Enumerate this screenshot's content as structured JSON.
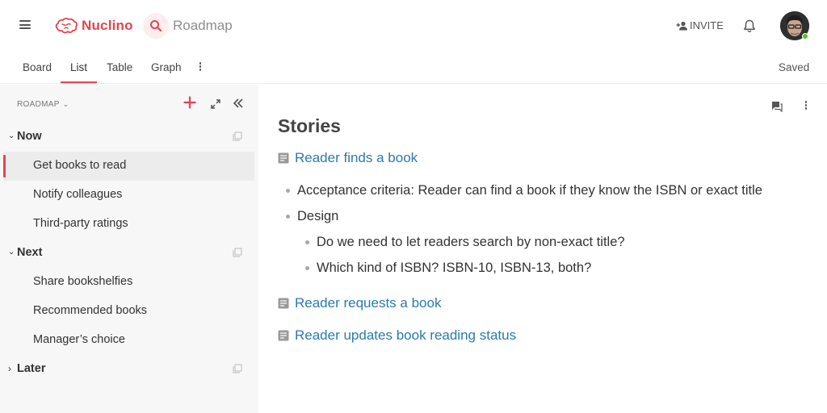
{
  "app": {
    "brand": "Nuclino",
    "workspace": "Roadmap",
    "accent": "#e6434f"
  },
  "header": {
    "invite_label": "INVITE",
    "icons": [
      "menu-icon",
      "brain-logo-icon",
      "search-icon",
      "add-person-icon",
      "bell-icon"
    ]
  },
  "tabs": [
    {
      "label": "Board"
    },
    {
      "label": "List"
    },
    {
      "label": "Table"
    },
    {
      "label": "Graph"
    }
  ],
  "active_tab": "List",
  "status": "Saved",
  "sidebar": {
    "header": "ROADMAP",
    "groups": [
      {
        "label": "Now",
        "expanded": true,
        "items": [
          {
            "label": "Get books to read",
            "active": true
          },
          {
            "label": "Notify colleagues"
          },
          {
            "label": "Third-party ratings"
          }
        ]
      },
      {
        "label": "Next",
        "expanded": true,
        "items": [
          {
            "label": "Share bookshelfies"
          },
          {
            "label": "Recommended books"
          },
          {
            "label": "Manager’s choice"
          }
        ]
      },
      {
        "label": "Later",
        "expanded": false,
        "items": []
      }
    ]
  },
  "document": {
    "title": "Stories",
    "links": [
      {
        "label": "Reader finds a book"
      },
      {
        "label": "Reader requests a book"
      },
      {
        "label": "Reader updates book reading status"
      }
    ],
    "bullets": [
      {
        "text": "Acceptance criteria: Reader can find a book if they know the ISBN or exact title"
      },
      {
        "text": "Design"
      }
    ],
    "sub_bullets": [
      {
        "text": "Do we need to let readers search by non-exact title?"
      },
      {
        "text": "Which kind of ISBN? ISBN-10, ISBN-13, both?"
      }
    ]
  }
}
